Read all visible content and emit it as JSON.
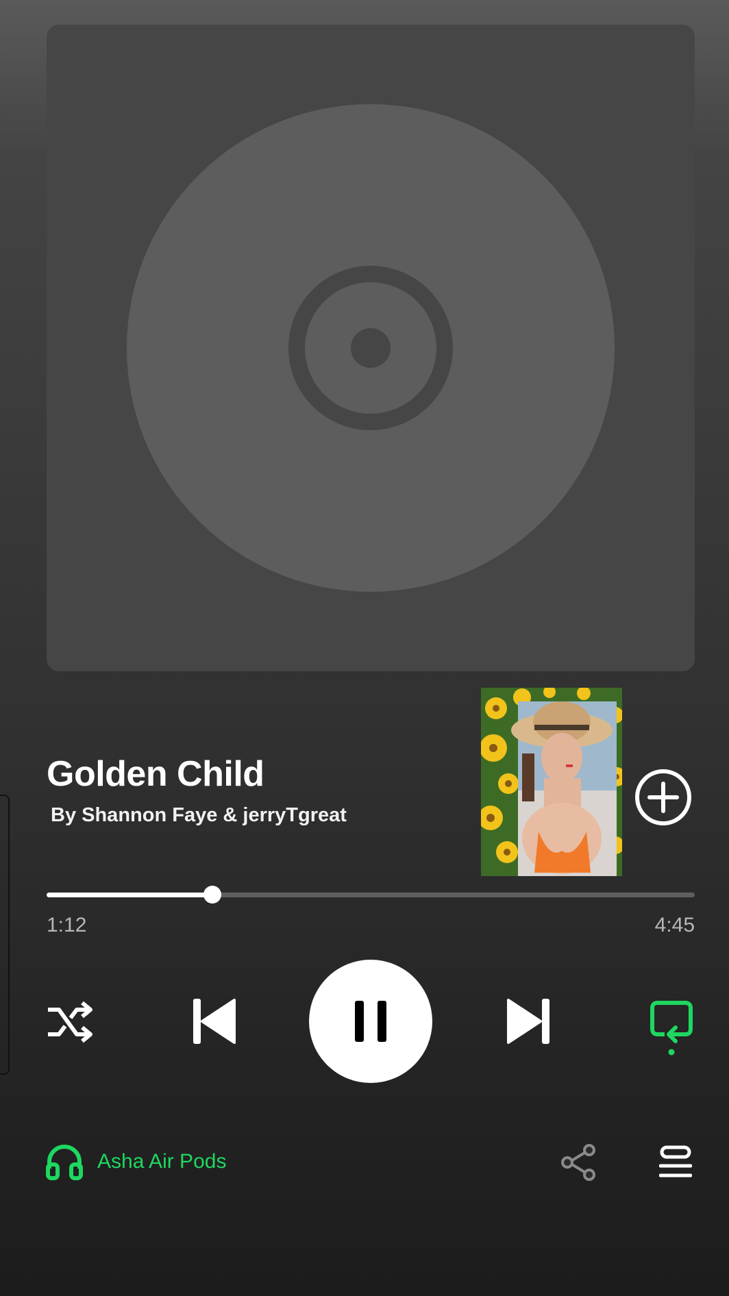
{
  "track": {
    "title": "Golden Child",
    "artist_line": "By Shannon Faye & jerryTgreat"
  },
  "playback": {
    "elapsed": "1:12",
    "duration": "4:45",
    "progress": 0.256,
    "state": "playing",
    "repeat": "on",
    "shuffle": "off"
  },
  "device": {
    "name": "Asha Air Pods",
    "icon": "headphones-icon"
  },
  "icons": {
    "add": "add-circle-icon",
    "shuffle": "shuffle-icon",
    "previous": "skip-previous-icon",
    "pause": "pause-icon",
    "next": "skip-next-icon",
    "repeat": "repeat-icon",
    "share": "share-icon",
    "queue": "queue-icon",
    "artwork_placeholder": "disc-icon"
  },
  "colors": {
    "accent": "#1ed760",
    "background_top": "#5a5a5a",
    "background_bottom": "#1c1c1c",
    "artwork_bg": "#464646",
    "disc": "#5d5d5d",
    "text_primary": "#ffffff",
    "text_secondary": "#b8b8b8"
  }
}
